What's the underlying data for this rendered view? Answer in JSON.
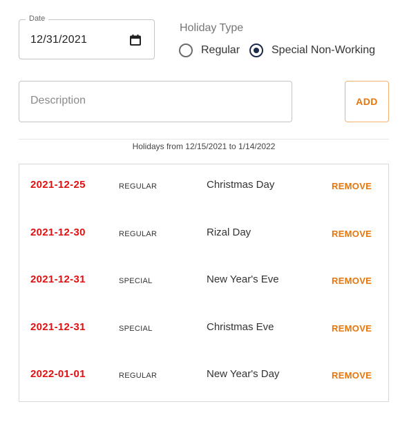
{
  "form": {
    "date": {
      "label": "Date",
      "value": "12/31/2021",
      "icon": "calendar-icon"
    },
    "holiday_type": {
      "legend": "Holiday Type",
      "options": [
        {
          "label": "Regular",
          "checked": false
        },
        {
          "label": "Special Non-Working",
          "checked": true
        }
      ]
    },
    "description": {
      "placeholder": "Description",
      "value": ""
    },
    "add_label": "ADD"
  },
  "range_caption": "Holidays from 12/15/2021 to 1/14/2022",
  "holidays": [
    {
      "date": "2021-12-25",
      "type": "REGULAR",
      "name": "Christmas Day",
      "remove_label": "REMOVE"
    },
    {
      "date": "2021-12-30",
      "type": "REGULAR",
      "name": "Rizal Day",
      "remove_label": "REMOVE"
    },
    {
      "date": "2021-12-31",
      "type": "SPECIAL",
      "name": "New Year's Eve",
      "remove_label": "REMOVE"
    },
    {
      "date": "2021-12-31",
      "type": "SPECIAL",
      "name": "Christmas Eve",
      "remove_label": "REMOVE"
    },
    {
      "date": "2022-01-01",
      "type": "REGULAR",
      "name": "New Year's Day",
      "remove_label": "REMOVE"
    }
  ],
  "colors": {
    "accent": "#e8750a",
    "date_red": "#e01010",
    "radio_checked": "#1b2a4a"
  }
}
